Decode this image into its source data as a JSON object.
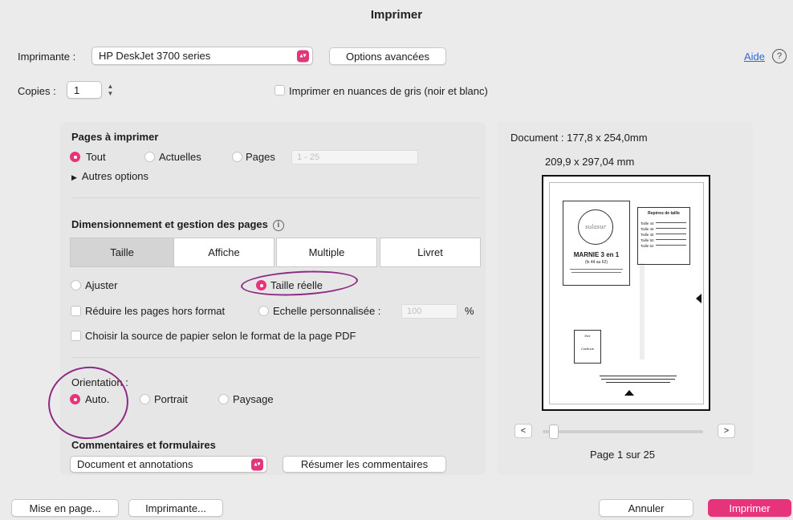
{
  "dialog": {
    "title": "Imprimer"
  },
  "printer": {
    "label": "Imprimante :",
    "value": "HP DeskJet 3700 series",
    "advanced_label": "Options avancées",
    "help_label": "Aide"
  },
  "copies": {
    "label": "Copies :",
    "value": "1",
    "grayscale_label": "Imprimer en nuances de gris (noir et blanc)"
  },
  "pages": {
    "title": "Pages à imprimer",
    "all_label": "Tout",
    "current_label": "Actuelles",
    "pages_label": "Pages",
    "range_value": "1 - 25",
    "more_label": "Autres options"
  },
  "sizing": {
    "title": "Dimensionnement et gestion des pages",
    "tabs": [
      "Taille",
      "Affiche",
      "Multiple",
      "Livret"
    ],
    "fit_label": "Ajuster",
    "actual_label": "Taille réelle",
    "shrink_label": "Réduire les pages hors format",
    "custom_label": "Echelle personnalisée :",
    "custom_value": "100",
    "percent": "%",
    "source_label": "Choisir la source de papier selon le format de la page PDF"
  },
  "orientation": {
    "label": "Orientation :",
    "auto_label": "Auto.",
    "portrait_label": "Portrait",
    "landscape_label": "Paysage"
  },
  "comments": {
    "title": "Commentaires et formulaires",
    "value": "Document et annotations",
    "summarize_label": "Résumer les commentaires"
  },
  "preview": {
    "document_size": "Document : 177,8 x 254,0mm",
    "paper_size": "209,9 x 297,04 mm",
    "prev": "<",
    "next": ">",
    "page_indicator": "Page 1 sur 25",
    "slider_fraction": 0.04,
    "sheet": {
      "title": "MARNIE 3 en 1",
      "subtitle": "(fs 44 au 62)",
      "logo_text": "sulasur",
      "table_title": "Repères de taille",
      "sizes": [
        "Taille 44",
        "Taille 46",
        "Taille 48",
        "Taille 50",
        "Taille 52"
      ],
      "box_label": "Eire",
      "box_value": "Continue"
    }
  },
  "footer": {
    "page_setup_label": "Mise en page...",
    "printer_label": "Imprimante...",
    "cancel_label": "Annuler",
    "print_label": "Imprimer"
  },
  "colors": {
    "accent": "#e7337a",
    "annotation": "#8e2a84",
    "link": "#2b6cd8"
  }
}
